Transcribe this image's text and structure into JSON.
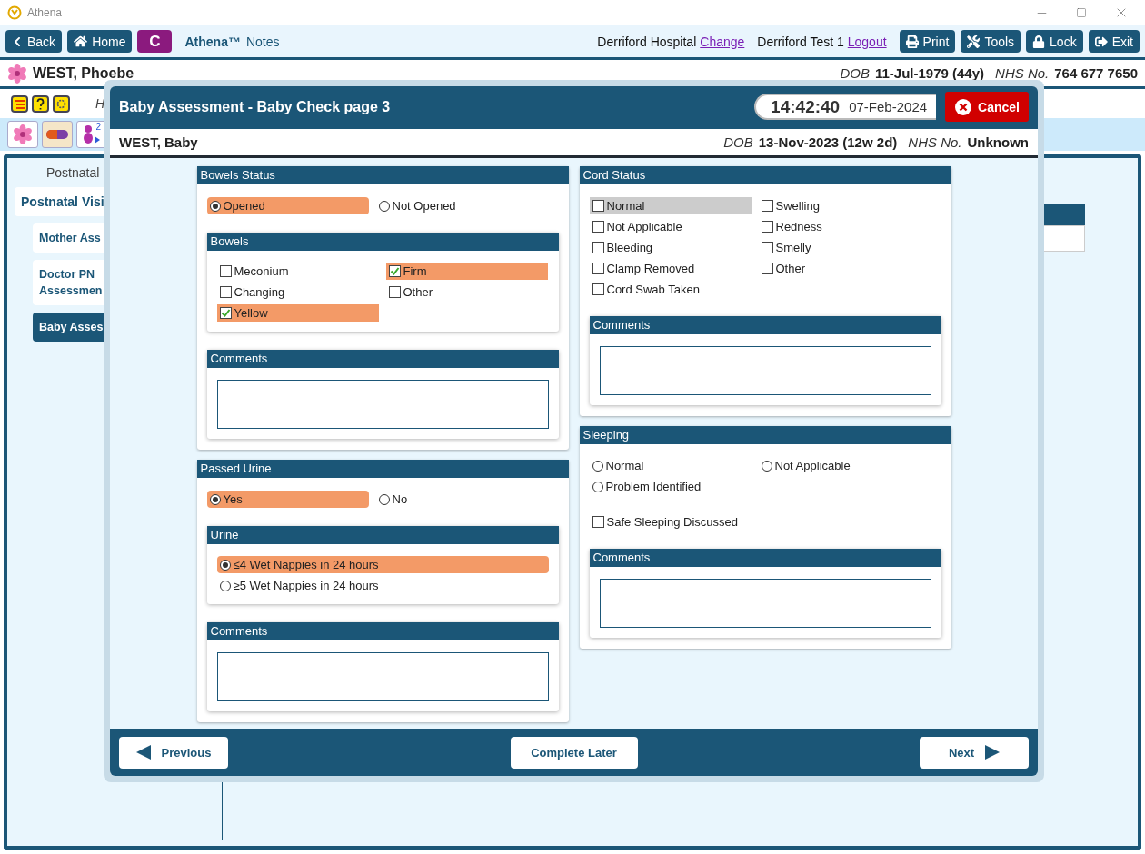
{
  "app": {
    "title": "Athena"
  },
  "toolbar": {
    "back": "Back",
    "home": "Home",
    "badge": "C",
    "brand": "Athena™",
    "product": "Notes",
    "location": "Derriford Hospital",
    "change_link": "Change",
    "user": "Derriford Test 1",
    "logout_link": "Logout",
    "buttons": [
      {
        "kind": "print",
        "label": "Print"
      },
      {
        "kind": "tools",
        "label": "Tools"
      },
      {
        "kind": "lock",
        "label": "Lock"
      },
      {
        "kind": "exit",
        "label": "Exit"
      }
    ]
  },
  "patient": {
    "name": "WEST, Phoebe",
    "dob_label": "DOB",
    "dob": "11-Jul-1979 (44y)",
    "nhs_label": "NHS No.",
    "nhs": "764 677 7650"
  },
  "alert_row": {
    "text": "H"
  },
  "icon_row": {
    "baby_count": "2"
  },
  "nav": [
    {
      "kind": "heading",
      "label": "Postnatal"
    },
    {
      "kind": "item",
      "label": "Postnatal Visi",
      "selected": false
    },
    {
      "kind": "subitem",
      "label": "Mother Ass",
      "selected": false
    },
    {
      "kind": "subitem",
      "label": "Doctor PN Assessmen",
      "selected": false
    },
    {
      "kind": "subitem",
      "label": "Baby Asses",
      "selected": true
    }
  ],
  "modal": {
    "title": "Baby Assessment - Baby Check page 3",
    "time": "14:42:40",
    "date": "07-Feb-2024",
    "cancel": "Cancel",
    "patient": {
      "name": "WEST, Baby",
      "dob_label": "DOB",
      "dob": "13-Nov-2023 (12w 2d)",
      "nhs_label": "NHS No.",
      "nhs": "Unknown"
    },
    "columns": [
      [
        {
          "title": "Bowels Status",
          "blocks": [
            {
              "kind": "radios",
              "columns": [
                [
                  {
                    "label": "Opened",
                    "selected": true
                  }
                ],
                [
                  {
                    "label": "Not Opened",
                    "selected": false
                  }
                ]
              ]
            },
            {
              "kind": "panel",
              "title": "Bowels",
              "blocks": [
                {
                  "kind": "checks",
                  "columns": [
                    [
                      {
                        "label": "Meconium",
                        "checked": false
                      },
                      {
                        "label": "Changing",
                        "checked": false
                      },
                      {
                        "label": "Yellow",
                        "checked": true
                      }
                    ],
                    [
                      {
                        "label": "Firm",
                        "checked": true
                      },
                      {
                        "label": "Other",
                        "checked": false
                      }
                    ]
                  ]
                }
              ]
            },
            {
              "kind": "panel",
              "title": "Comments",
              "blocks": [
                {
                  "kind": "comment"
                }
              ]
            }
          ]
        },
        {
          "title": "Passed Urine",
          "blocks": [
            {
              "kind": "radios",
              "columns": [
                [
                  {
                    "label": "Yes",
                    "selected": true
                  }
                ],
                [
                  {
                    "label": "No",
                    "selected": false
                  }
                ]
              ]
            },
            {
              "kind": "panel",
              "title": "Urine",
              "blocks": [
                {
                  "kind": "radios",
                  "columns": [
                    [
                      {
                        "label": "≤4 Wet Nappies in 24 hours",
                        "selected": true
                      },
                      {
                        "label": "≥5 Wet Nappies in 24 hours",
                        "selected": false
                      }
                    ]
                  ]
                }
              ]
            },
            {
              "kind": "panel",
              "title": "Comments",
              "blocks": [
                {
                  "kind": "comment"
                }
              ]
            }
          ]
        }
      ],
      [
        {
          "title": "Cord Status",
          "blocks": [
            {
              "kind": "checks",
              "columns": [
                [
                  {
                    "label": "Normal",
                    "checked": false,
                    "focused": true
                  },
                  {
                    "label": "Not Applicable",
                    "checked": false,
                    "focused": false
                  },
                  {
                    "label": "Bleeding",
                    "checked": false,
                    "focused": false
                  },
                  {
                    "label": "Clamp Removed",
                    "checked": false,
                    "focused": false
                  },
                  {
                    "label": "Cord Swab Taken",
                    "checked": false,
                    "focused": false
                  }
                ],
                [
                  {
                    "label": "Swelling",
                    "checked": false,
                    "focused": false
                  },
                  {
                    "label": "Redness",
                    "checked": false,
                    "focused": false
                  },
                  {
                    "label": "Smelly",
                    "checked": false,
                    "focused": false
                  },
                  {
                    "label": "Other",
                    "checked": false,
                    "focused": false
                  }
                ]
              ]
            },
            {
              "kind": "panel",
              "title": "Comments",
              "blocks": [
                {
                  "kind": "comment"
                }
              ]
            }
          ]
        },
        {
          "title": "Sleeping",
          "blocks": [
            {
              "kind": "radios",
              "columns": [
                [
                  {
                    "label": "Normal",
                    "selected": false
                  },
                  {
                    "label": "Problem Identified",
                    "selected": false
                  }
                ],
                [
                  {
                    "label": "Not Applicable",
                    "selected": false
                  }
                ]
              ]
            },
            {
              "kind": "checks",
              "columns": [
                [
                  {
                    "label": "Safe Sleeping Discussed",
                    "checked": false
                  }
                ]
              ]
            },
            {
              "kind": "panel",
              "title": "Comments",
              "blocks": [
                {
                  "kind": "comment"
                }
              ]
            }
          ]
        }
      ]
    ],
    "footer": {
      "previous": "Previous",
      "complete_later": "Complete Later",
      "next": "Next"
    }
  }
}
